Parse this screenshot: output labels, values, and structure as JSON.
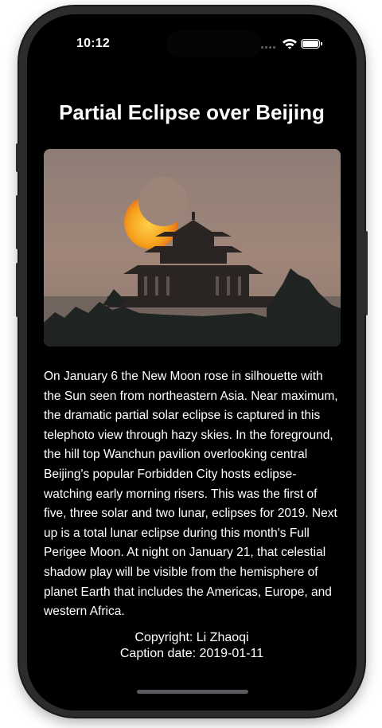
{
  "status_bar": {
    "time": "10:12"
  },
  "apod": {
    "title": "Partial Eclipse over Beijing",
    "image_alt": "Partial solar eclipse rising behind the Wanchun pavilion",
    "explanation": "On January 6 the New Moon rose in silhouette with the Sun seen from northeastern Asia. Near maximum, the dramatic partial solar eclipse is captured in this telephoto view through hazy skies. In the foreground, the hill top Wanchun pavilion overlooking central Beijing's popular Forbidden City hosts eclipse-watching early morning risers. This was the first of five, three solar and two lunar, eclipses for 2019. Next up is a total lunar eclipse during this month's Full Perigee Moon. At night on January 21, that celestial shadow play will be visible from the hemisphere of planet Earth that includes the Americas, Europe, and western Africa.",
    "copyright": "Copyright: Li Zhaoqi",
    "caption_date": "Caption date: 2019-01-11"
  },
  "colors": {
    "background": "#000000",
    "text": "#ffffff",
    "sun": "#f6a21c",
    "sky": "#9a847a"
  },
  "icons": {
    "signal": "cellular-signal-icon",
    "wifi": "wifi-icon",
    "battery": "battery-icon"
  }
}
